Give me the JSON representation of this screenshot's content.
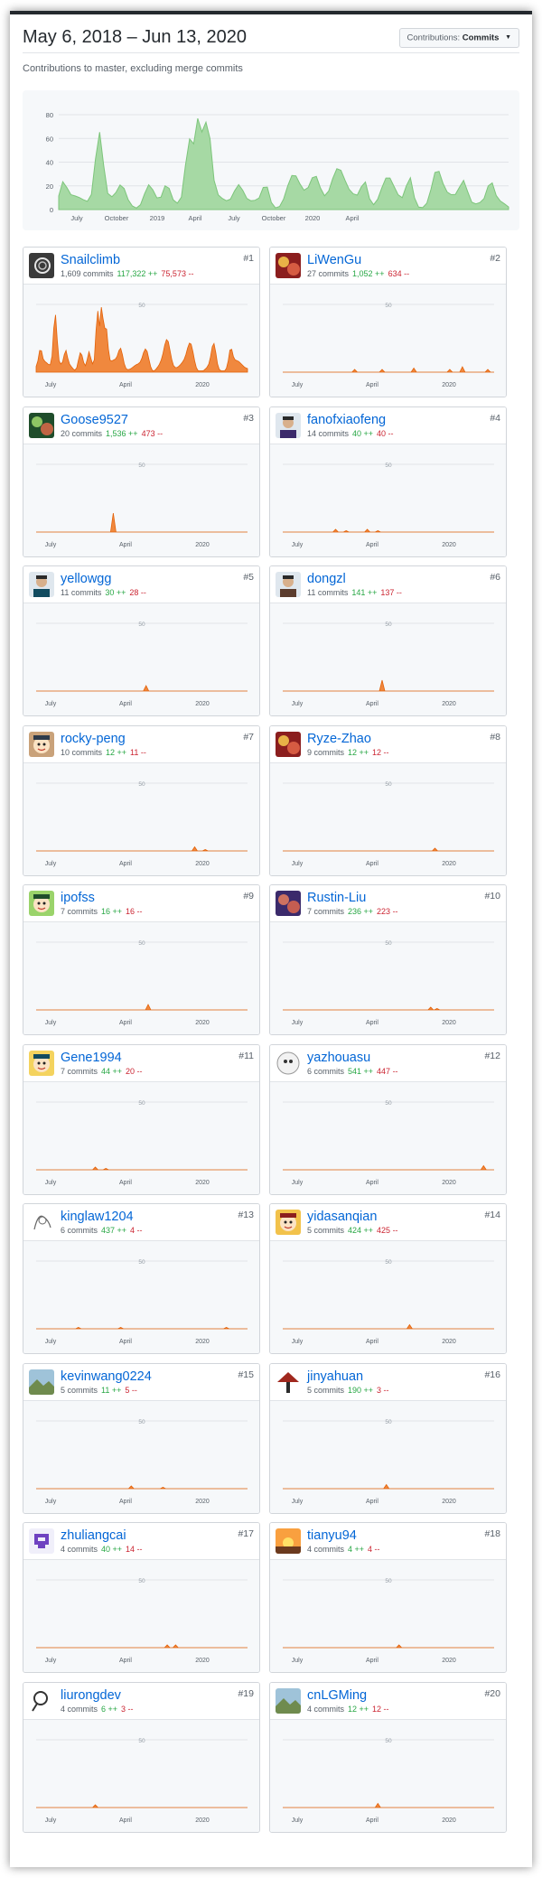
{
  "header": {
    "date_range": "May 6, 2018 – Jun 13, 2020",
    "contributions_button_prefix": "Contributions:",
    "contributions_button_value": "Commits",
    "subtitle": "Contributions to master, excluding merge commits"
  },
  "colors": {
    "overview_fill": "#a6d9a4",
    "overview_stroke": "#7dc57b",
    "contributor_fill": "#f0883e",
    "contributor_stroke": "#e36209",
    "link": "#0366d6",
    "additions": "#28a745",
    "deletions": "#cb2431"
  },
  "overview": {
    "y_ticks": [
      "80",
      "60",
      "40",
      "20",
      "0"
    ],
    "x_ticks": [
      "July",
      "October",
      "2019",
      "April",
      "July",
      "October",
      "2020",
      "April"
    ],
    "y_max": 80
  },
  "card_chart_labels": {
    "gridline": "50",
    "x_ticks": [
      "July",
      "April",
      "2020"
    ]
  },
  "contributors": [
    {
      "name": "Snailclimb",
      "rank": "#1",
      "commits": "1,609 commits",
      "additions": "117,322 ++",
      "deletions": "75,573 --",
      "avatar": "snail-avatar",
      "spikes": []
    },
    {
      "name": "LiWenGu",
      "rank": "#2",
      "commits": "27 commits",
      "additions": "1,052 ++",
      "deletions": "634 --",
      "avatar": "photo-avatar",
      "spikes": [
        [
          0.34,
          2
        ],
        [
          0.47,
          2
        ],
        [
          0.62,
          3
        ],
        [
          0.79,
          2
        ],
        [
          0.85,
          4
        ],
        [
          0.97,
          2
        ]
      ]
    },
    {
      "name": "Goose9527",
      "rank": "#3",
      "commits": "20 commits",
      "additions": "1,536 ++",
      "deletions": "473 --",
      "avatar": "abstract-avatar",
      "spikes": [
        [
          0.365,
          14
        ]
      ]
    },
    {
      "name": "fanofxiaofeng",
      "rank": "#4",
      "commits": "14 commits",
      "additions": "40 ++",
      "deletions": "40 --",
      "avatar": "portrait-avatar",
      "spikes": [
        [
          0.25,
          2
        ],
        [
          0.3,
          1
        ],
        [
          0.4,
          2
        ],
        [
          0.45,
          1
        ]
      ]
    },
    {
      "name": "yellowgg",
      "rank": "#5",
      "commits": "11 commits",
      "additions": "30 ++",
      "deletions": "28 --",
      "avatar": "portrait-avatar",
      "spikes": [
        [
          0.52,
          4
        ]
      ]
    },
    {
      "name": "dongzl",
      "rank": "#6",
      "commits": "11 commits",
      "additions": "141 ++",
      "deletions": "137 --",
      "avatar": "portrait-avatar",
      "spikes": [
        [
          0.47,
          8
        ]
      ]
    },
    {
      "name": "rocky-peng",
      "rank": "#7",
      "commits": "10 commits",
      "additions": "12 ++",
      "deletions": "11 --",
      "avatar": "cartoon-avatar",
      "spikes": [
        [
          0.75,
          3
        ],
        [
          0.8,
          1
        ]
      ]
    },
    {
      "name": "Ryze-Zhao",
      "rank": "#8",
      "commits": "9 commits",
      "additions": "12 ++",
      "deletions": "12 --",
      "avatar": "abstract-avatar",
      "spikes": [
        [
          0.72,
          2
        ]
      ]
    },
    {
      "name": "ipofss",
      "rank": "#9",
      "commits": "7 commits",
      "additions": "16 ++",
      "deletions": "16 --",
      "avatar": "cartoon-avatar",
      "spikes": [
        [
          0.53,
          4
        ]
      ]
    },
    {
      "name": "Rustin-Liu",
      "rank": "#10",
      "commits": "7 commits",
      "additions": "236 ++",
      "deletions": "223 --",
      "avatar": "photo-avatar",
      "spikes": [
        [
          0.7,
          2
        ],
        [
          0.73,
          1
        ]
      ]
    },
    {
      "name": "Gene1994",
      "rank": "#11",
      "commits": "7 commits",
      "additions": "44 ++",
      "deletions": "20 --",
      "avatar": "cartoon-avatar",
      "spikes": [
        [
          0.28,
          2
        ],
        [
          0.33,
          1
        ]
      ]
    },
    {
      "name": "yazhouasu",
      "rank": "#12",
      "commits": "6 commits",
      "additions": "541 ++",
      "deletions": "447 --",
      "avatar": "round-avatar",
      "spikes": [
        [
          0.95,
          3
        ]
      ]
    },
    {
      "name": "kinglaw1204",
      "rank": "#13",
      "commits": "6 commits",
      "additions": "437 ++",
      "deletions": "4 --",
      "avatar": "sketch-avatar",
      "spikes": [
        [
          0.2,
          1
        ],
        [
          0.4,
          1
        ],
        [
          0.9,
          1
        ]
      ]
    },
    {
      "name": "yidasanqian",
      "rank": "#14",
      "commits": "5 commits",
      "additions": "424 ++",
      "deletions": "425 --",
      "avatar": "cartoon-avatar",
      "spikes": [
        [
          0.6,
          3
        ]
      ]
    },
    {
      "name": "kevinwang0224",
      "rank": "#15",
      "commits": "5 commits",
      "additions": "11 ++",
      "deletions": "5 --",
      "avatar": "landscape-avatar",
      "spikes": [
        [
          0.45,
          2
        ],
        [
          0.6,
          1
        ]
      ]
    },
    {
      "name": "jinyahuan",
      "rank": "#16",
      "commits": "5 commits",
      "additions": "190 ++",
      "deletions": "3 --",
      "avatar": "house-avatar",
      "spikes": [
        [
          0.49,
          3
        ]
      ]
    },
    {
      "name": "zhuliangcai",
      "rank": "#17",
      "commits": "4 commits",
      "additions": "40 ++",
      "deletions": "14 --",
      "avatar": "pixel-avatar",
      "spikes": [
        [
          0.62,
          2
        ],
        [
          0.66,
          2
        ]
      ]
    },
    {
      "name": "tianyu94",
      "rank": "#18",
      "commits": "4 commits",
      "additions": "4 ++",
      "deletions": "4 --",
      "avatar": "sunset-avatar",
      "spikes": [
        [
          0.55,
          2
        ]
      ]
    },
    {
      "name": "liurongdev",
      "rank": "#19",
      "commits": "4 commits",
      "additions": "6 ++",
      "deletions": "3 --",
      "avatar": "magnifier-avatar",
      "spikes": [
        [
          0.28,
          2
        ]
      ]
    },
    {
      "name": "cnLGMing",
      "rank": "#20",
      "commits": "4 commits",
      "additions": "12 ++",
      "deletions": "12 --",
      "avatar": "landscape-avatar",
      "spikes": [
        [
          0.45,
          3
        ]
      ]
    }
  ]
}
